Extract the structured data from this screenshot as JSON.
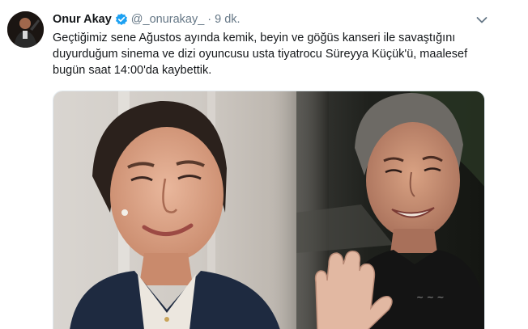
{
  "author": {
    "display_name": "Onur Akay",
    "username": "@_onurakay_",
    "separator": "·",
    "time": "9 dk.",
    "verified": true,
    "verified_color": "#1da1f2"
  },
  "tweet": {
    "lines": [
      "Geçtiğimiz sene Ağustos ayında kemik, beyin ve göğüs kanseri ile savaştığını",
      "duyurduğum sinema ve dizi oyuncusu usta tiyatrocu Süreyya Küçük'ü, maalesef",
      "bugün saat 14:00'da kaybettik."
    ]
  },
  "icons": {
    "verified": "verified-badge-icon",
    "menu": "chevron-down-icon"
  },
  "colors": {
    "text": "#14171a",
    "muted": "#657786",
    "accent": "#1da1f2"
  }
}
